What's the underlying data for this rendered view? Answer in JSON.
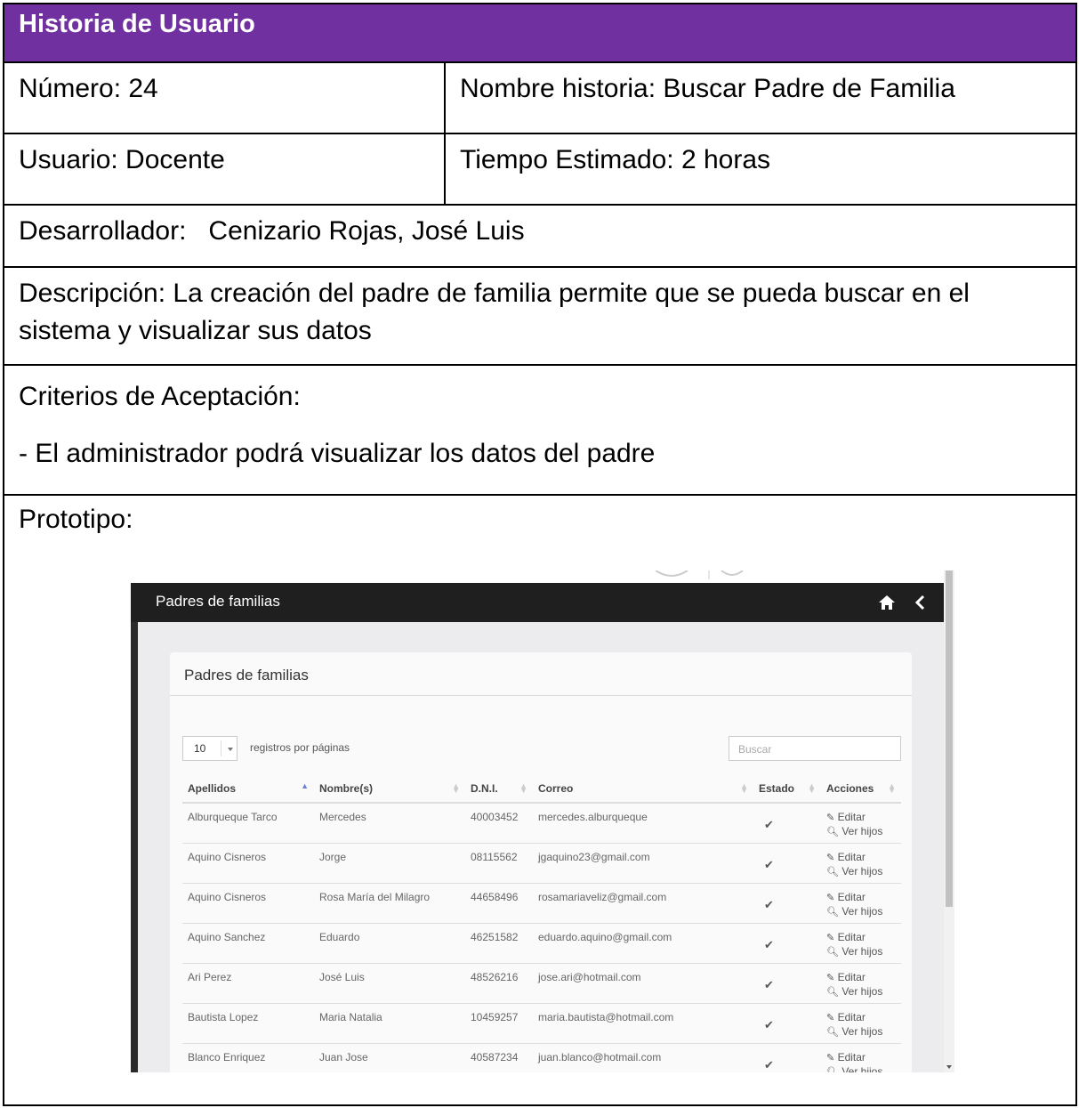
{
  "story": {
    "title": "Historia de Usuario",
    "numero": "Número: 24",
    "nombre": "Nombre historia: Buscar Padre de Familia",
    "usuario": "Usuario: Docente",
    "tiempo": "Tiempo Estimado: 2 horas",
    "desarrollador": "Desarrollador:   Cenizario Rojas, José Luis",
    "descripcion": " Descripción: La creación del padre de familia permite que se pueda buscar en el sistema y visualizar sus datos",
    "criterios_label": "Criterios de Aceptación:",
    "criterio_1": "-  El administrador podrá visualizar los datos del padre",
    "prototipo_label": "Prototipo:",
    "title_color": "#7030a0"
  },
  "prototype": {
    "navbar_title": "Padres de familias",
    "panel_title": "Padres de familias",
    "page_length": "10",
    "page_length_label": "registros por páginas",
    "search_placeholder": "Buscar",
    "columns": [
      "Apellidos",
      "Nombre(s)",
      "D.N.I.",
      "Correo",
      "Estado",
      "Acciones"
    ],
    "edit_label": "Editar",
    "children_label": "Ver hijos",
    "rows": [
      {
        "apellidos": "Alburqueque Tarco",
        "nombres": "Mercedes",
        "dni": "40003452",
        "correo": "mercedes.alburqueque"
      },
      {
        "apellidos": "Aquino Cisneros",
        "nombres": "Jorge",
        "dni": "08115562",
        "correo": "jgaquino23@gmail.com"
      },
      {
        "apellidos": "Aquino Cisneros",
        "nombres": "Rosa María del Milagro",
        "dni": "44658496",
        "correo": "rosamariaveliz@gmail.com"
      },
      {
        "apellidos": "Aquino Sanchez",
        "nombres": "Eduardo",
        "dni": "46251582",
        "correo": "eduardo.aquino@gmail.com"
      },
      {
        "apellidos": "Ari Perez",
        "nombres": "José Luis",
        "dni": "48526216",
        "correo": "jose.ari@hotmail.com"
      },
      {
        "apellidos": "Bautista Lopez",
        "nombres": "Maria Natalia",
        "dni": "10459257",
        "correo": "maria.bautista@hotmail.com"
      },
      {
        "apellidos": "Blanco Enriquez",
        "nombres": "Juan Jose",
        "dni": "40587234",
        "correo": "juan.blanco@hotmail.com"
      }
    ],
    "accent_color": "#2196f3"
  }
}
